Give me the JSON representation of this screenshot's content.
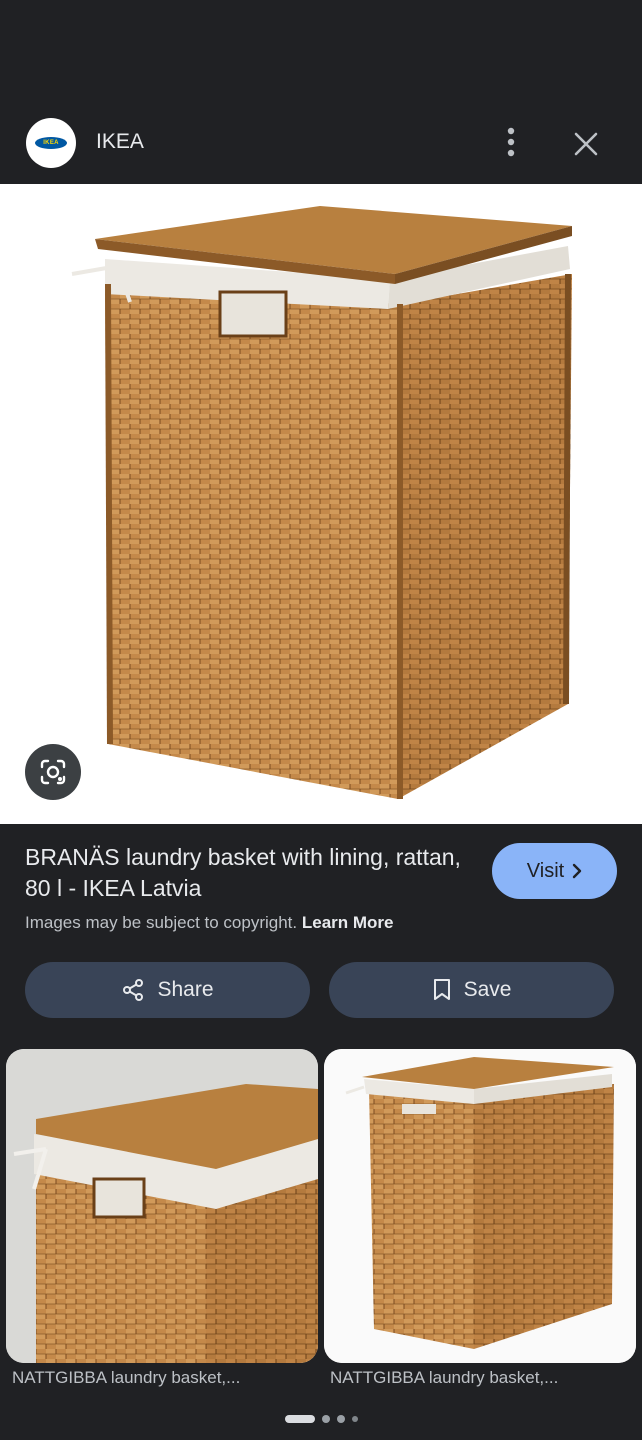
{
  "header": {
    "logo_text": "IKEA",
    "site_name": "IKEA",
    "menu_icon": "more-vertical-icon",
    "close_icon": "close-icon"
  },
  "result": {
    "title": "BRANÄS laundry basket with lining, rattan, 80 l - IKEA Latvia",
    "visit_label": "Visit",
    "copyright_text": "Images may be subject to copyright.",
    "learn_more": "Learn More"
  },
  "actions": {
    "share_label": "Share",
    "save_label": "Save"
  },
  "related": [
    {
      "caption": "NATTGIBBA laundry basket,..."
    },
    {
      "caption": "NATTGIBBA laundry basket,..."
    }
  ],
  "pager": {
    "current": 1,
    "total": 4
  },
  "colors": {
    "background": "#202124",
    "accent": "#8ab4f8",
    "action_button": "#394457",
    "rattan": "#c4894a"
  }
}
